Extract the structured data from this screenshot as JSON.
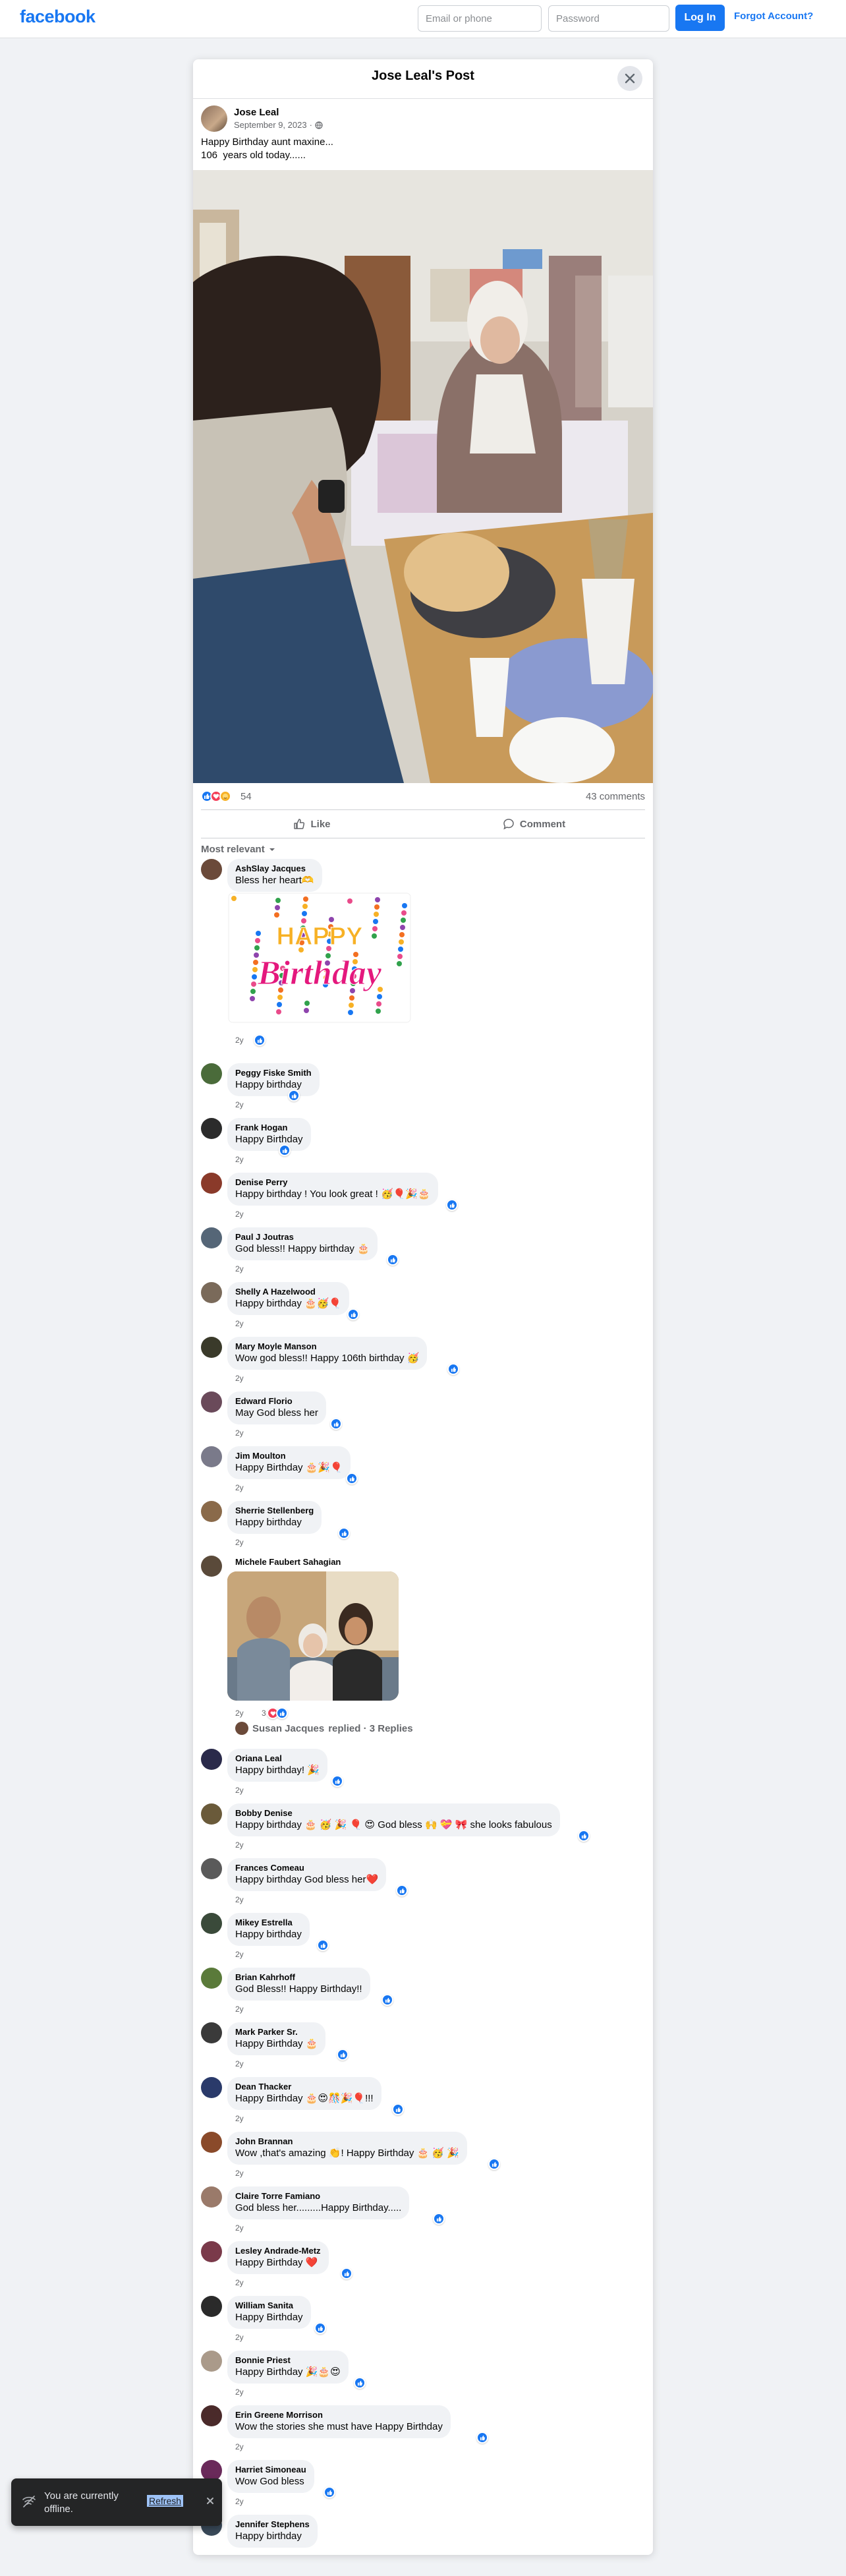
{
  "header": {
    "logo": "facebook",
    "email_placeholder": "Email or phone",
    "password_placeholder": "Password",
    "login_label": "Log In",
    "forgot_label": "Forgot Account?"
  },
  "post": {
    "modal_title": "Jose Leal's Post",
    "author": "Jose Leal",
    "date": "September 9, 2023",
    "meta_sep": "·",
    "text": "Happy Birthday aunt maxine...\n106  years old today......",
    "reaction_count": "54",
    "comment_count": "43 comments",
    "like_label": "Like",
    "comment_label": "Comment",
    "sort_label": "Most relevant"
  },
  "comments": [
    {
      "name": "AshSlay Jacques",
      "text": "Bless her heart🫶",
      "time": "2y",
      "avatar_color": "#6b4a3a"
    },
    {
      "name": "Peggy Fiske Smith",
      "text": "Happy birthday",
      "time": "2y",
      "avatar_color": "#4a6b3a"
    },
    {
      "name": "Frank Hogan",
      "text": "Happy Birthday",
      "time": "2y",
      "avatar_color": "#2b2b2b"
    },
    {
      "name": "Denise Perry",
      "text": "Happy birthday ! You look great ! 🥳🎈🎉🎂",
      "time": "2y",
      "avatar_color": "#8a3a2a"
    },
    {
      "name": "Paul J Joutras",
      "text": "God bless!! Happy birthday 🎂",
      "time": "2y",
      "avatar_color": "#556677"
    },
    {
      "name": "Shelly A Hazelwood",
      "text": "Happy birthday 🎂🥳🎈",
      "time": "2y",
      "avatar_color": "#7a6a5a"
    },
    {
      "name": "Mary Moyle Manson",
      "text": "Wow god bless!! Happy 106th birthday 🥳",
      "time": "2y",
      "avatar_color": "#3a3a2a"
    },
    {
      "name": "Edward Florio",
      "text": "May God bless her",
      "time": "2y",
      "avatar_color": "#6a4a5a"
    },
    {
      "name": "Jim Moulton",
      "text": "Happy Birthday 🎂🎉🎈",
      "time": "2y",
      "avatar_color": "#7a7a8a"
    },
    {
      "name": "Sherrie Stellenberg",
      "text": "Happy birthday",
      "time": "2y",
      "avatar_color": "#8a6a4a"
    },
    {
      "name": "Michele Faubert Sahagian",
      "text": "",
      "time": "2y",
      "avatar_color": "#5a4a3a",
      "reaction_count": "3"
    },
    {
      "name": "Oriana Leal",
      "text": "Happy birthday! 🎉",
      "time": "2y",
      "avatar_color": "#2a2a4a"
    },
    {
      "name": "Bobby Denise",
      "text": "Happy birthday 🎂 🥳 🎉 🎈 😍 God bless 🙌 💝 🎀 she looks fabulous",
      "time": "2y",
      "avatar_color": "#6a5a3a"
    },
    {
      "name": "Frances Comeau",
      "text": "Happy birthday God bless her❤️",
      "time": "2y",
      "avatar_color": "#5a5a5a"
    },
    {
      "name": "Mikey Estrella",
      "text": "Happy birthday",
      "time": "2y",
      "avatar_color": "#3a4a3a"
    },
    {
      "name": "Brian Kahrhoff",
      "text": "God Bless!! Happy Birthday!!",
      "time": "2y",
      "avatar_color": "#5a7a3a"
    },
    {
      "name": "Mark Parker Sr.",
      "text": "Happy Birthday 🎂",
      "time": "2y",
      "avatar_color": "#3a3a3a"
    },
    {
      "name": "Dean Thacker",
      "text": "Happy Birthday 🎂😍🎊🎉🎈!!!",
      "time": "2y",
      "avatar_color": "#2a3a6a"
    },
    {
      "name": "John Brannan",
      "text": "Wow ,that's amazing 👏! Happy Birthday 🎂 🥳 🎉",
      "time": "2y",
      "avatar_color": "#8a4a2a"
    },
    {
      "name": "Claire Torre Famiano",
      "text": "God bless her.........Happy Birthday.....",
      "time": "2y",
      "avatar_color": "#9a7a6a"
    },
    {
      "name": "Lesley Andrade-Metz",
      "text": "Happy Birthday ❤️",
      "time": "2y",
      "avatar_color": "#7a3a4a"
    },
    {
      "name": "William Sanita",
      "text": "Happy Birthday",
      "time": "2y",
      "avatar_color": "#2a2a2a"
    },
    {
      "name": "Bonnie Priest",
      "text": "Happy Birthday 🎉🎂😍",
      "time": "2y",
      "avatar_color": "#aa9a8a"
    },
    {
      "name": "Erin Greene Morrison",
      "text": "Wow the stories she must have Happy Birthday",
      "time": "2y",
      "avatar_color": "#4a2a2a"
    },
    {
      "name": "Harriet Simoneau",
      "text": "Wow God bless",
      "time": "2y",
      "avatar_color": "#6a2a5a"
    },
    {
      "name": "Jennifer Stephens",
      "text": "Happy birthday",
      "time": "",
      "avatar_color": "#3a4a5a"
    }
  ],
  "reply_summary": {
    "name": "Susan Jacques",
    "text": "replied · 3 Replies"
  },
  "sticker": {
    "line1": "HAPPY",
    "line2": "Birthday"
  },
  "toast": {
    "text": "You are currently offline.",
    "refresh": "Refresh"
  },
  "colors": {
    "brand": "#1877f2",
    "like": "#1877f2",
    "love": "#f33e58",
    "care": "#f7b125"
  }
}
